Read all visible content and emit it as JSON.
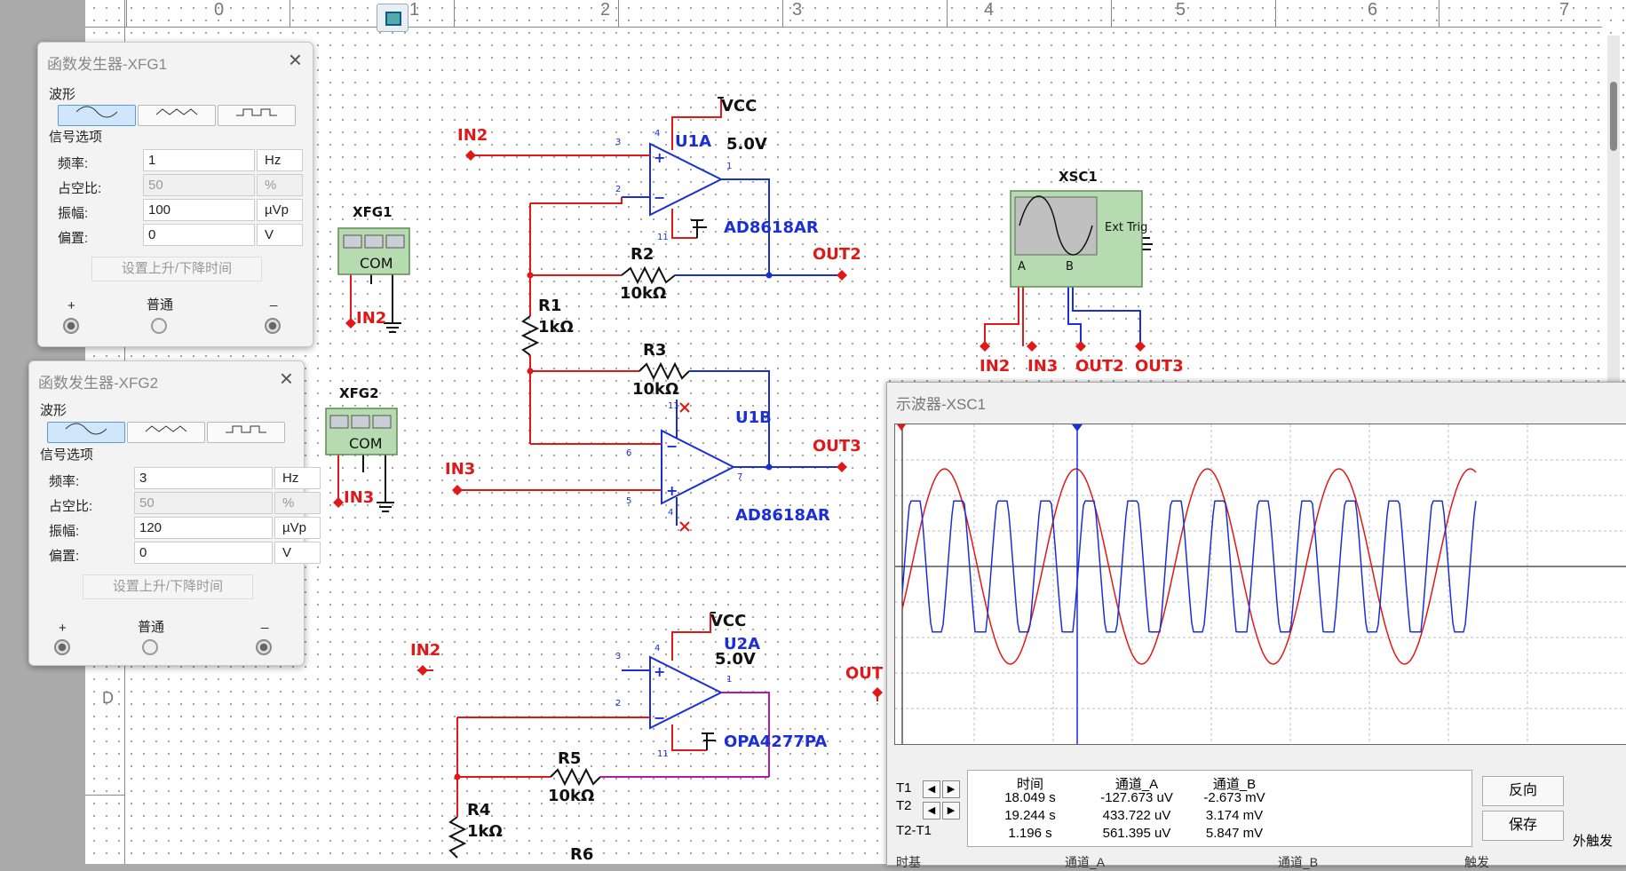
{
  "ruler": {
    "numbers": [
      "0",
      "1",
      "2",
      "3",
      "4",
      "5",
      "6",
      "7"
    ]
  },
  "zone_label": "D",
  "schematic": {
    "components": {
      "u1a_ref": "U1A",
      "u1b_ref": "U1B",
      "u2a_ref": "U2A",
      "u1a_part": "AD8618AR",
      "u1b_part": "AD8618AR",
      "u2a_part": "OPA4277PA",
      "vcc1": "VCC",
      "vcc1_val": "5.0V",
      "vcc2": "VCC",
      "vcc2_val": "5.0V",
      "r1": "R1",
      "r1_val": "1kΩ",
      "r2": "R2",
      "r2_val": "10kΩ",
      "r3": "R3",
      "r3_val": "10kΩ",
      "r4": "R4",
      "r4_val": "1kΩ",
      "r5": "R5",
      "r5_val": "10kΩ",
      "r6": "R6",
      "xfg1": "XFG1",
      "xfg2": "XFG2",
      "xsc1": "XSC1",
      "com1": "COM",
      "com2": "COM",
      "ext_trig": "Ext Trig",
      "ch_a": "A",
      "ch_b": "B"
    },
    "nets": {
      "in2_a": "IN2",
      "in3_a": "IN3",
      "out2_a": "OUT2",
      "out3_a": "OUT3",
      "in2_b": "IN2",
      "in3_b": "IN3",
      "in2_c": "IN2",
      "sc_in2": "IN2",
      "sc_in3": "IN3",
      "sc_out2": "OUT2",
      "sc_out3": "OUT3",
      "out_partial": "OUT"
    },
    "pins": {
      "p3a": "3",
      "p4a": "4",
      "p2a": "2",
      "p1a": "1",
      "p11a": "11",
      "p11b": "11",
      "p6b": "6",
      "p7b": "7",
      "p5b": "5",
      "p4b": "4",
      "p3c": "3",
      "p4c": "4",
      "p2c": "2",
      "p1c": "1",
      "p11c": "11"
    }
  },
  "fg1": {
    "title": "函数发生器-XFG1",
    "waveform_label": "波形",
    "signal_label": "信号选项",
    "freq_label": "频率:",
    "freq": "1",
    "freq_unit": "Hz",
    "duty_label": "占空比:",
    "duty": "50",
    "duty_unit": "%",
    "amp_label": "振幅:",
    "amp": "100",
    "amp_unit": "µVp",
    "offset_label": "偏置:",
    "offset": "0",
    "offset_unit": "V",
    "rise_btn": "设置上升/下降时间",
    "plus": "+",
    "common": "普通",
    "minus": "_",
    "selected_waveform": "sine"
  },
  "fg2": {
    "title": "函数发生器-XFG2",
    "waveform_label": "波形",
    "signal_label": "信号选项",
    "freq_label": "频率:",
    "freq": "3",
    "freq_unit": "Hz",
    "duty_label": "占空比:",
    "duty": "50",
    "duty_unit": "%",
    "amp_label": "振幅:",
    "amp": "120",
    "amp_unit": "µVp",
    "offset_label": "偏置:",
    "offset": "0",
    "offset_unit": "V",
    "rise_btn": "设置上升/下降时间",
    "plus": "+",
    "common": "普通",
    "minus": "_",
    "selected_waveform": "sine"
  },
  "osc": {
    "title": "示波器-XSC1",
    "headers": {
      "time": "时间",
      "ch_a": "通道_A",
      "ch_b": "通道_B"
    },
    "rows": [
      {
        "label": "T1",
        "time": "18.049 s",
        "a": "-127.673 uV",
        "b": "-2.673 mV"
      },
      {
        "label": "T2",
        "time": "19.244 s",
        "a": "433.722 uV",
        "b": "3.174 mV"
      },
      {
        "label": "T2-T1",
        "time": "1.196 s",
        "a": "561.395 uV",
        "b": "5.847 mV"
      }
    ],
    "reverse_btn": "反向",
    "save_btn": "保存",
    "ext_trigger": "外触发",
    "bottom_labels": [
      "时基",
      "通道_A",
      "通道_B",
      "触发"
    ],
    "trace_colors": {
      "a": "#e01818",
      "b": "#1a2fd6"
    }
  }
}
